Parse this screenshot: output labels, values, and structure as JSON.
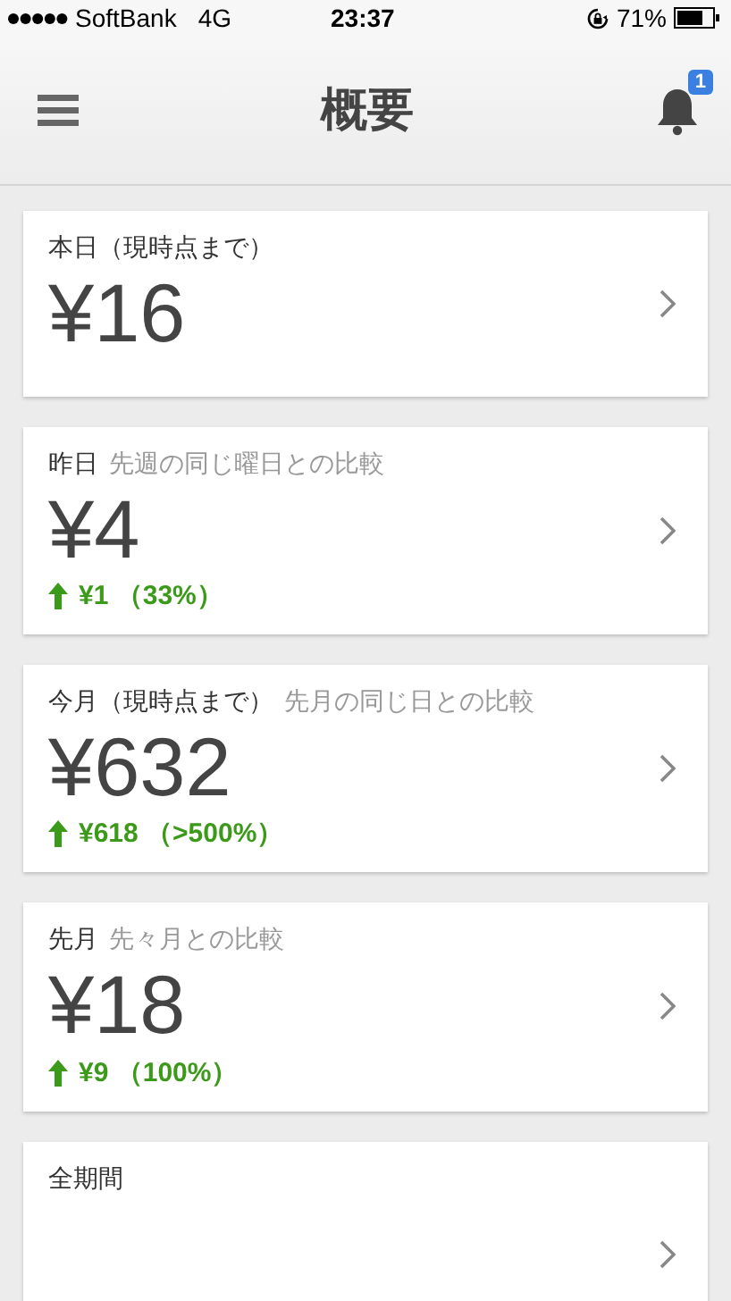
{
  "status_bar": {
    "carrier": "SoftBank",
    "network": "4G",
    "time": "23:37",
    "battery": "71%"
  },
  "header": {
    "title": "概要",
    "notification_count": "1"
  },
  "cards": [
    {
      "label": "本日（現時点まで）",
      "amount": "¥16"
    },
    {
      "label": "昨日",
      "comparison": "先週の同じ曜日との比較",
      "amount": "¥4",
      "change": {
        "kind": "increase",
        "text": "¥1 （33%）"
      }
    },
    {
      "label": "今月（現時点まで）",
      "comparison": "先月の同じ日との比較",
      "amount": "¥632",
      "change": {
        "kind": "increase",
        "text": "¥618 （>500%）"
      }
    },
    {
      "label": "先月",
      "comparison": "先々月との比較",
      "amount": "¥18",
      "change": {
        "kind": "increase",
        "text": "¥9 （100%）"
      }
    },
    {
      "label": "全期間"
    }
  ]
}
